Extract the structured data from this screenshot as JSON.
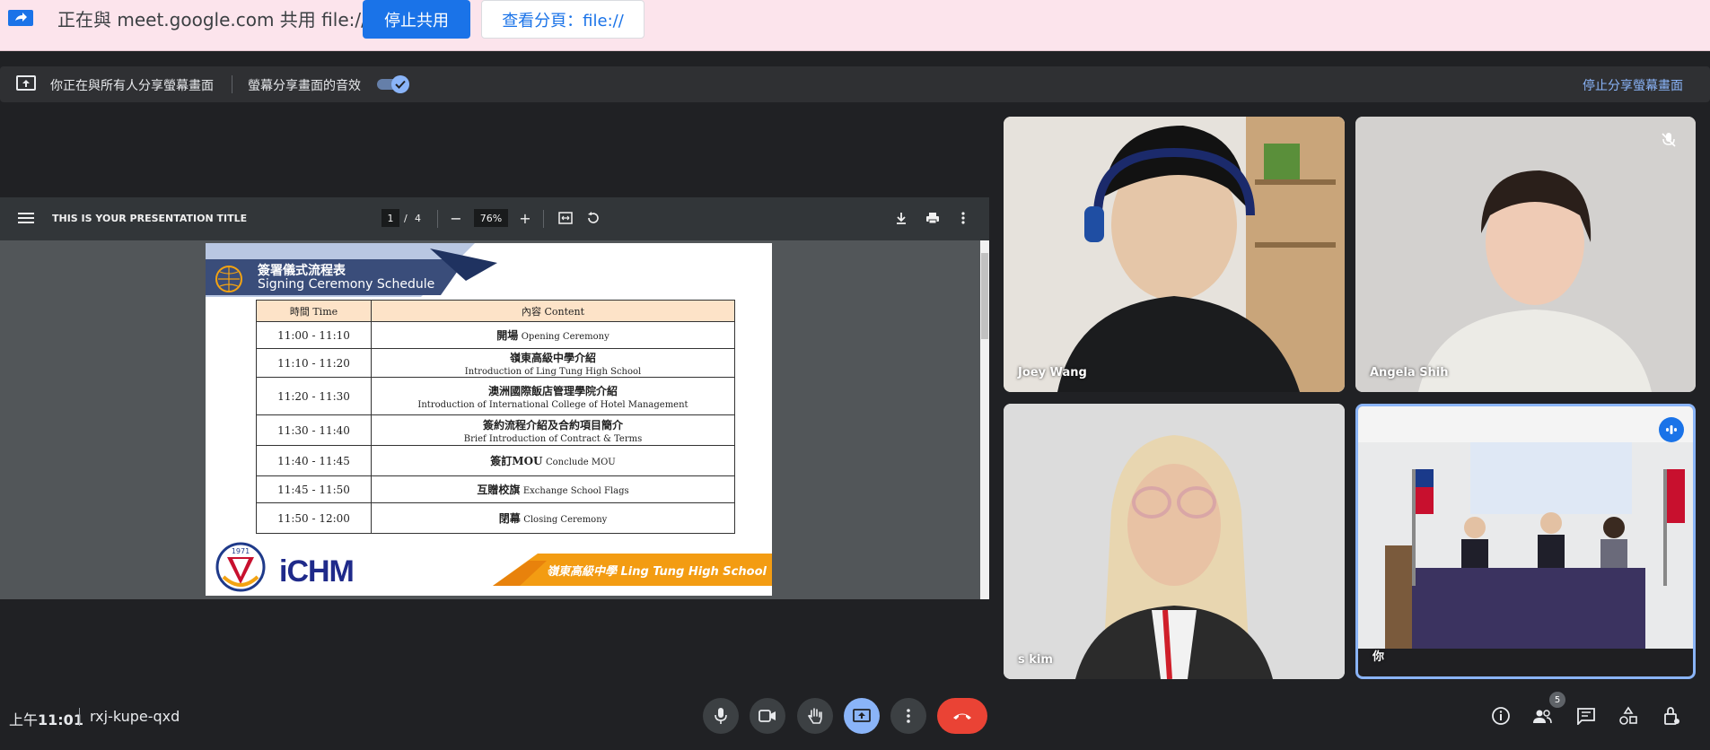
{
  "share_bar": {
    "message": "正在與 meet.google.com 共用 file://",
    "stop_label": "停止共用",
    "view_label": "查看分頁：file://"
  },
  "present_bar": {
    "notice": "你正在與所有人分享螢幕畫面",
    "audio_label": "螢幕分享畫面的音效",
    "audio_enabled": true,
    "stop_label": "停止分享螢幕畫面"
  },
  "pdf_viewer": {
    "title": "THIS IS YOUR PRESENTATION TITLE",
    "page_current": "1",
    "page_sep": "/",
    "page_total": "4",
    "zoom": "76%",
    "slide": {
      "heading_zh": "簽署儀式流程表",
      "heading_en": "Signing Ceremony Schedule",
      "col_time": "時間 Time",
      "col_content": "內容 Content",
      "rows": [
        {
          "time": "11:00 - 11:10",
          "zh": "開場",
          "en": "Opening Ceremony"
        },
        {
          "time": "11:10 - 11:20",
          "zh": "嶺東高級中學介紹",
          "en": "Introduction of Ling Tung High School"
        },
        {
          "time": "11:20 - 11:30",
          "zh": "澳洲國際飯店管理學院介紹",
          "en": "Introduction of International College of Hotel Management"
        },
        {
          "time": "11:30 - 11:40",
          "zh": "簽約流程介紹及合約項目簡介",
          "en": "Brief Introduction of Contract & Terms"
        },
        {
          "time": "11:40 - 11:45",
          "zh": "簽訂MOU",
          "en": "Conclude MOU"
        },
        {
          "time": "11:45 - 11:50",
          "zh": "互贈校旗",
          "en": "Exchange School Flags"
        },
        {
          "time": "11:50 - 12:00",
          "zh": "閉幕",
          "en": "Closing Ceremony"
        }
      ],
      "ichm_logo": "iCHM",
      "footer": "嶺東高級中學 Ling Tung High School",
      "school_year": "1971"
    }
  },
  "participants": [
    {
      "name": "Joey Wang"
    },
    {
      "name": "Angela Shih",
      "muted": true
    },
    {
      "name": "s kim"
    },
    {
      "name": "你",
      "speaking": true
    }
  ],
  "bottom_bar": {
    "time_prefix": "上午",
    "time": "11:01",
    "meeting_code": "rxj-kupe-qxd",
    "people_count": "5"
  },
  "colors": {
    "accent": "#1a73e8",
    "end_call": "#ea4335",
    "share_bar_bg": "#fce4ec",
    "link": "#8ab4f8"
  },
  "icons": [
    "present-icon",
    "menu-icon",
    "download-icon",
    "print-icon",
    "more-icon",
    "mic-icon",
    "camera-icon",
    "raise-hand-icon",
    "present-now-icon",
    "end-call-icon",
    "info-icon",
    "people-icon",
    "chat-icon",
    "activities-icon",
    "host-controls-icon",
    "mic-off-icon",
    "speaking-icon"
  ]
}
